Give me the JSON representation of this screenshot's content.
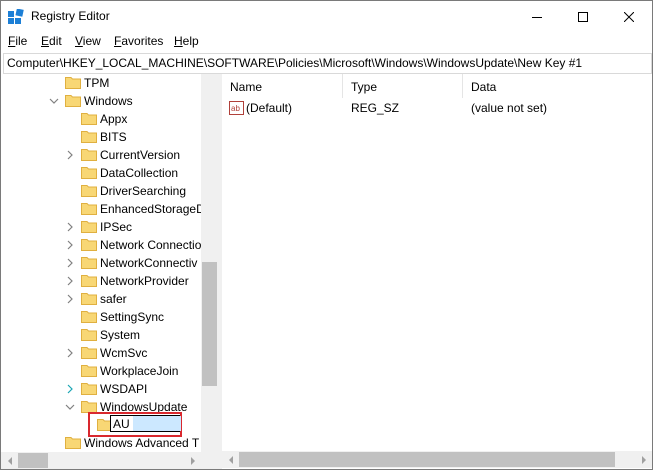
{
  "window": {
    "title": "Registry Editor",
    "controls": [
      "minimize",
      "maximize",
      "close"
    ]
  },
  "menu": {
    "items": [
      {
        "label": "File",
        "accel": "F",
        "rest": "ile"
      },
      {
        "label": "Edit",
        "accel": "E",
        "rest": "dit"
      },
      {
        "label": "View",
        "accel": "V",
        "rest": "iew"
      },
      {
        "label": "Favorites",
        "accel": "F",
        "rest": "avorites"
      },
      {
        "label": "Help",
        "accel": "H",
        "rest": "elp"
      }
    ]
  },
  "address": {
    "path": "Computer\\HKEY_LOCAL_MACHINE\\SOFTWARE\\Policies\\Microsoft\\Windows\\WindowsUpdate\\New Key #1"
  },
  "tree": {
    "items": [
      {
        "label": "TPM",
        "level": 1,
        "expander": "none"
      },
      {
        "label": "Windows",
        "level": 1,
        "expander": "expanded"
      },
      {
        "label": "Appx",
        "level": 2,
        "expander": "none"
      },
      {
        "label": "BITS",
        "level": 2,
        "expander": "none"
      },
      {
        "label": "CurrentVersion",
        "level": 2,
        "expander": "collapsed"
      },
      {
        "label": "DataCollection",
        "level": 2,
        "expander": "none"
      },
      {
        "label": "DriverSearching",
        "level": 2,
        "expander": "none"
      },
      {
        "label": "EnhancedStorageD",
        "level": 2,
        "expander": "none"
      },
      {
        "label": "IPSec",
        "level": 2,
        "expander": "collapsed"
      },
      {
        "label": "Network Connectio",
        "level": 2,
        "expander": "collapsed"
      },
      {
        "label": "NetworkConnectiv",
        "level": 2,
        "expander": "collapsed"
      },
      {
        "label": "NetworkProvider",
        "level": 2,
        "expander": "collapsed"
      },
      {
        "label": "safer",
        "level": 2,
        "expander": "collapsed"
      },
      {
        "label": "SettingSync",
        "level": 2,
        "expander": "none"
      },
      {
        "label": "System",
        "level": 2,
        "expander": "none"
      },
      {
        "label": "WcmSvc",
        "level": 2,
        "expander": "collapsed"
      },
      {
        "label": "WorkplaceJoin",
        "level": 2,
        "expander": "none"
      },
      {
        "label": "WSDAPI",
        "level": 2,
        "expander": "collapsed-hover"
      },
      {
        "label": "WindowsUpdate",
        "level": 2,
        "expander": "expanded"
      },
      {
        "label": "",
        "level": 3,
        "expander": "none",
        "editing": true
      },
      {
        "label": "Windows Advanced T",
        "level": 1,
        "expander": "none"
      }
    ],
    "edit_value": "AU"
  },
  "list": {
    "columns": [
      "Name",
      "Type",
      "Data"
    ],
    "rows": [
      {
        "icon": "string-value-icon",
        "name": "(Default)",
        "type": "REG_SZ",
        "data": "(value not set)"
      }
    ]
  },
  "colors": {
    "folder": "#f8d775",
    "folder_dark": "#e0b040",
    "highlight_border": "#d9282e",
    "selection": "#cce8ff",
    "scrollbar_track": "#f0f0f0",
    "scrollbar_thumb": "#c1c1c1"
  }
}
